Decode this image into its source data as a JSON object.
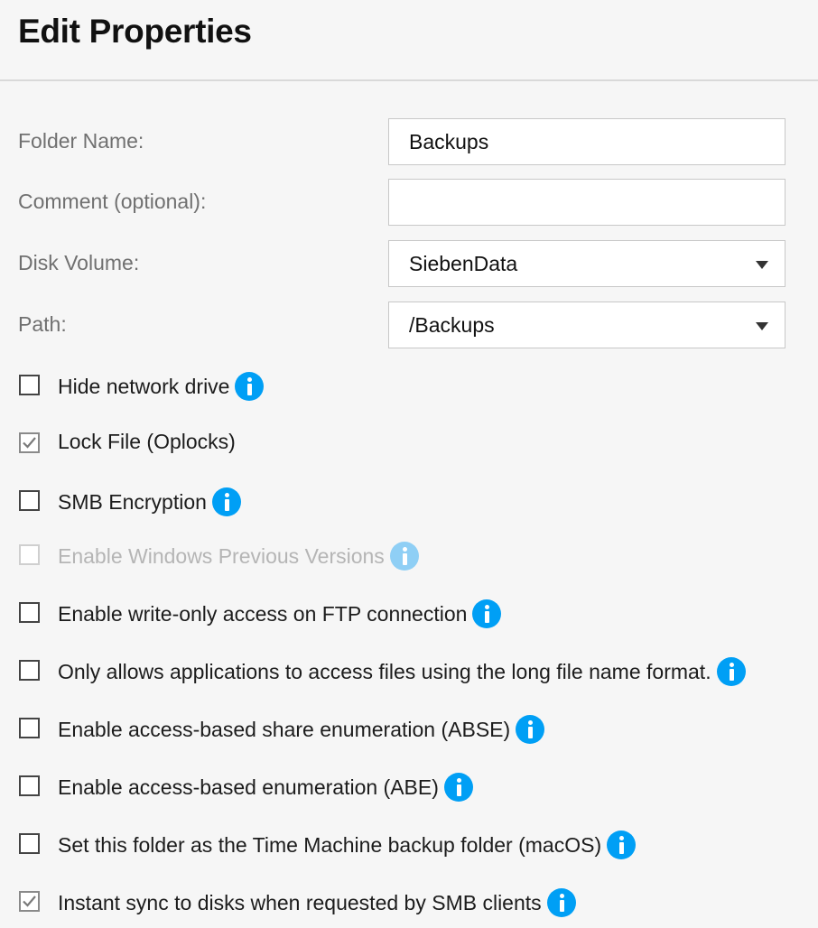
{
  "dialog": {
    "title": "Edit Properties"
  },
  "fields": {
    "folder_name": {
      "label": "Folder Name:",
      "value": "Backups"
    },
    "comment": {
      "label": "Comment (optional):",
      "value": ""
    },
    "disk_volume": {
      "label": "Disk Volume:",
      "value": "SiebenData"
    },
    "path": {
      "label": "Path:",
      "value": "/Backups"
    }
  },
  "options": [
    {
      "label": "Hide network drive",
      "checked": false,
      "disabled": false,
      "info": true
    },
    {
      "label": "Lock File (Oplocks)",
      "checked": true,
      "disabled": false,
      "info": false
    },
    {
      "label": "SMB Encryption",
      "checked": false,
      "disabled": false,
      "info": true
    },
    {
      "label": "Enable Windows Previous Versions",
      "checked": false,
      "disabled": true,
      "info": true
    },
    {
      "label": "Enable write-only access on FTP connection",
      "checked": false,
      "disabled": false,
      "info": true
    },
    {
      "label": "Only allows applications to access files using the long file name format.",
      "checked": false,
      "disabled": false,
      "info": true
    },
    {
      "label": "Enable access-based share enumeration (ABSE)",
      "checked": false,
      "disabled": false,
      "info": true
    },
    {
      "label": "Enable access-based enumeration (ABE)",
      "checked": false,
      "disabled": false,
      "info": true
    },
    {
      "label": "Set this folder as the Time Machine backup folder (macOS)",
      "checked": false,
      "disabled": false,
      "info": true
    },
    {
      "label": "Instant sync to disks when requested by SMB clients",
      "checked": true,
      "disabled": false,
      "info": true
    }
  ],
  "colors": {
    "accent": "#009ff5",
    "accent_disabled": "#8fcff5",
    "label_gray": "#707070"
  },
  "icons": {
    "info": "info-icon",
    "dropdown": "chevron-down-icon",
    "check": "checkmark-icon"
  }
}
